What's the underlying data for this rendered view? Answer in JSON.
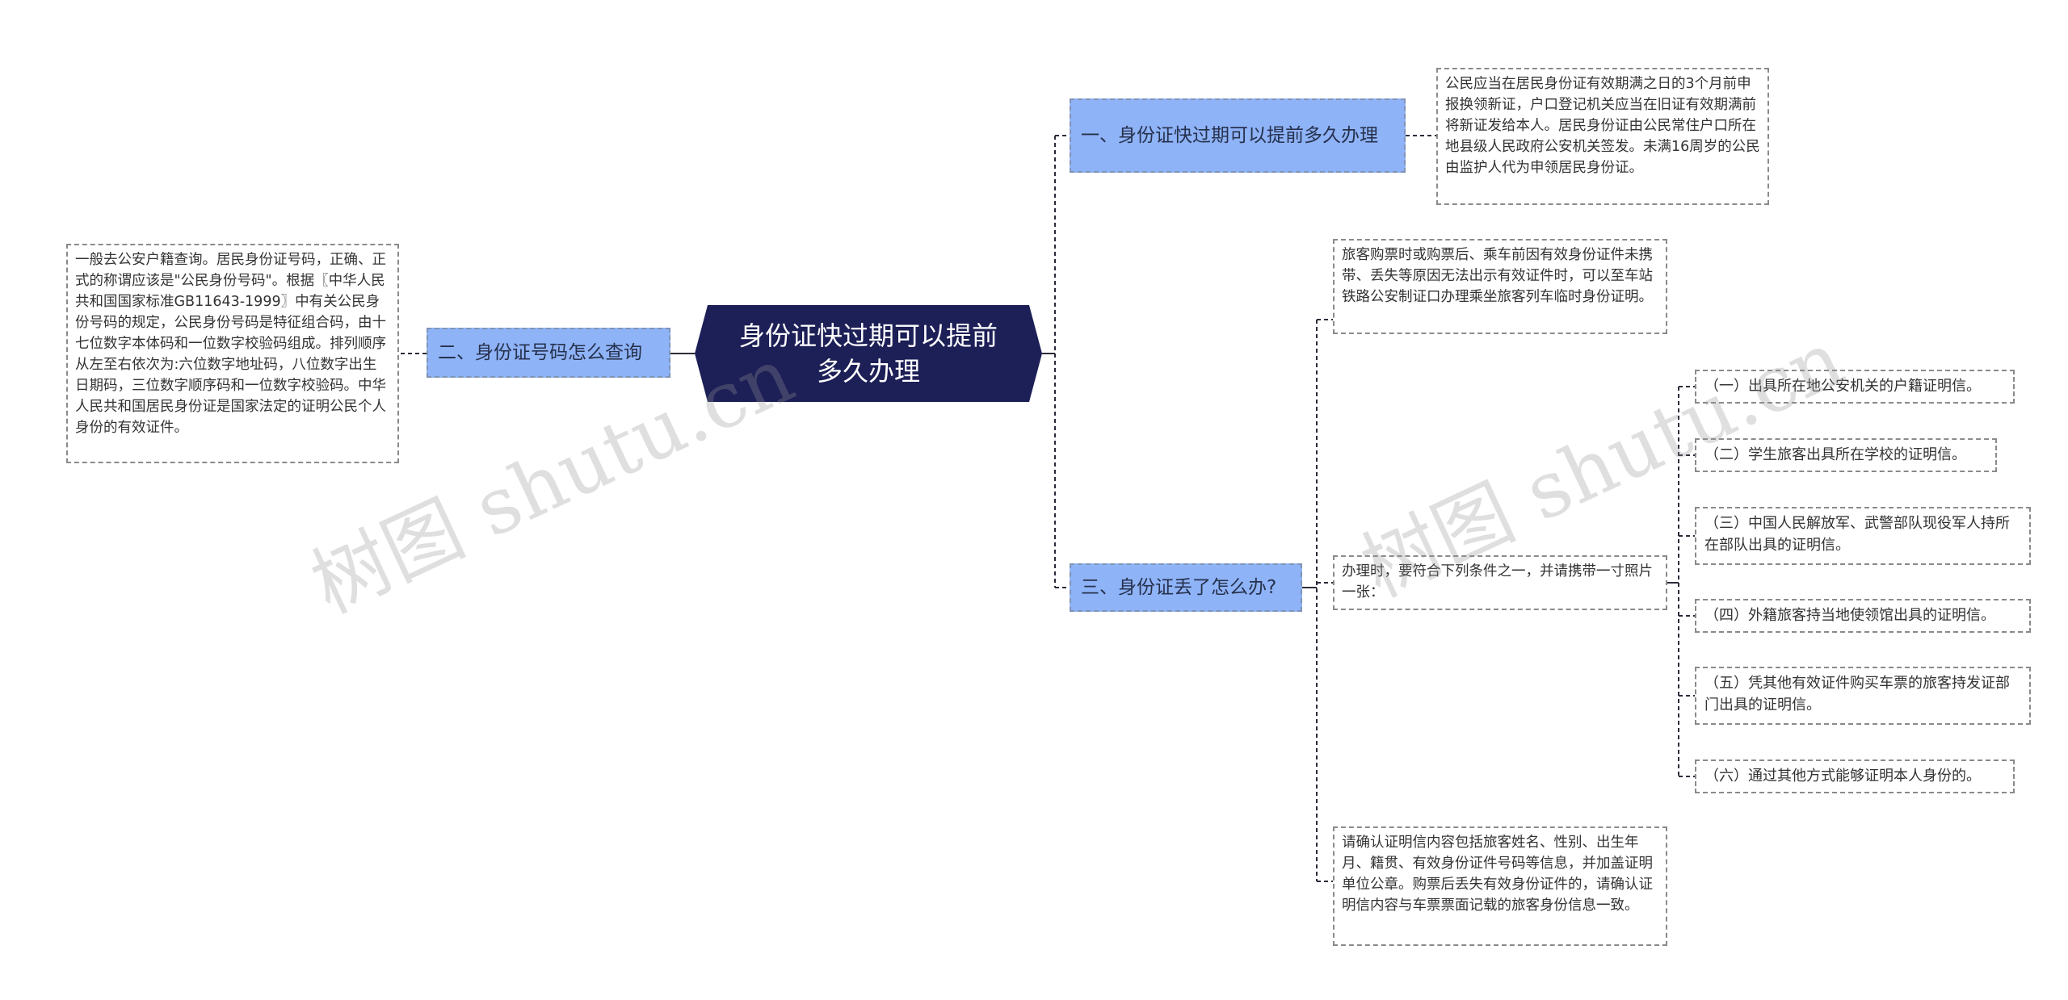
{
  "root": {
    "label": "身份证快过期可以提前多久办理"
  },
  "branches": [
    {
      "label": "一、身份证快过期可以提前多久办理"
    },
    {
      "label": "二、身份证号码怎么查询"
    },
    {
      "label": "三、身份证丢了怎么办?"
    }
  ],
  "leaves": {
    "b1_detail": "公民应当在居民身份证有效期满之日的3个月前申报换领新证，户口登记机关应当在旧证有效期满前将新证发给本人。居民身份证由公民常住户口所在地县级人民政府公安机关签发。未满16周岁的公民由监护人代为申领居民身份证。",
    "b2_detail": "一般去公安户籍查询。居民身份证号码，正确、正式的称谓应该是\"公民身份号码\"。根据〖中华人民共和国国家标准GB11643-1999〗中有关公民身份号码的规定，公民身份号码是特征组合码，由十七位数字本体码和一位数字校验码组成。排列顺序从左至右依次为:六位数字地址码，八位数字出生日期码，三位数字顺序码和一位数字校验码。中华人民共和国居民身份证是国家法定的证明公民个人身份的有效证件。",
    "b3_travel": "旅客购票时或购票后、乘车前因有效身份证件未携带、丢失等原因无法出示有效证件时，可以至车站铁路公安制证口办理乘坐旅客列车临时身份证明。",
    "b3_conditions": "办理时，要符合下列条件之一，并请携带一寸照片一张：",
    "b3_confirm": "请确认证明信内容包括旅客姓名、性别、出生年月、籍贯、有效身份证件号码等信息，并加盖证明单位公章。购票后丢失有效身份证件的，请确认证明信内容与车票票面记载的旅客身份信息一致。"
  },
  "conditions": [
    "（一）出具所在地公安机关的户籍证明信。",
    "（二）学生旅客出具所在学校的证明信。",
    "（三）中国人民解放军、武警部队现役军人持所在部队出具的证明信。",
    "（四）外籍旅客持当地使领馆出具的证明信。",
    "（五）凭其他有效证件购买车票的旅客持发证部门出具的证明信。",
    "（六）通过其他方式能够证明本人身份的。"
  ],
  "watermark": "树图 shutu.cn",
  "colors": {
    "root_bg": "#1d1f57",
    "branch_bg": "#8fb3f7",
    "edge": "#2b2b3a"
  }
}
